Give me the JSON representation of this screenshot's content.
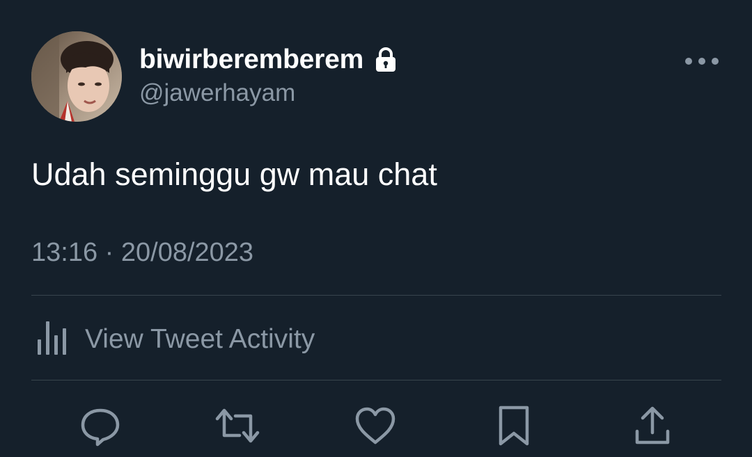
{
  "tweet": {
    "display_name": "biwirberemberem",
    "handle": "@jawerhayam",
    "text": "Udah seminggu gw mau chat",
    "timestamp": "13:16 · 20/08/2023",
    "protected_icon": "lock-icon",
    "more_icon": "more-dots-icon"
  },
  "activity": {
    "label": "View Tweet Activity",
    "icon": "bar-chart-icon"
  },
  "actions": [
    {
      "name": "reply",
      "icon": "reply-icon"
    },
    {
      "name": "retweet",
      "icon": "retweet-icon"
    },
    {
      "name": "like",
      "icon": "heart-icon"
    },
    {
      "name": "bookmark",
      "icon": "bookmark-icon"
    },
    {
      "name": "share",
      "icon": "share-icon"
    }
  ],
  "colors": {
    "background": "#15202b",
    "primary_text": "#ffffff",
    "secondary_text": "#8b98a5",
    "divider": "#38444d"
  }
}
